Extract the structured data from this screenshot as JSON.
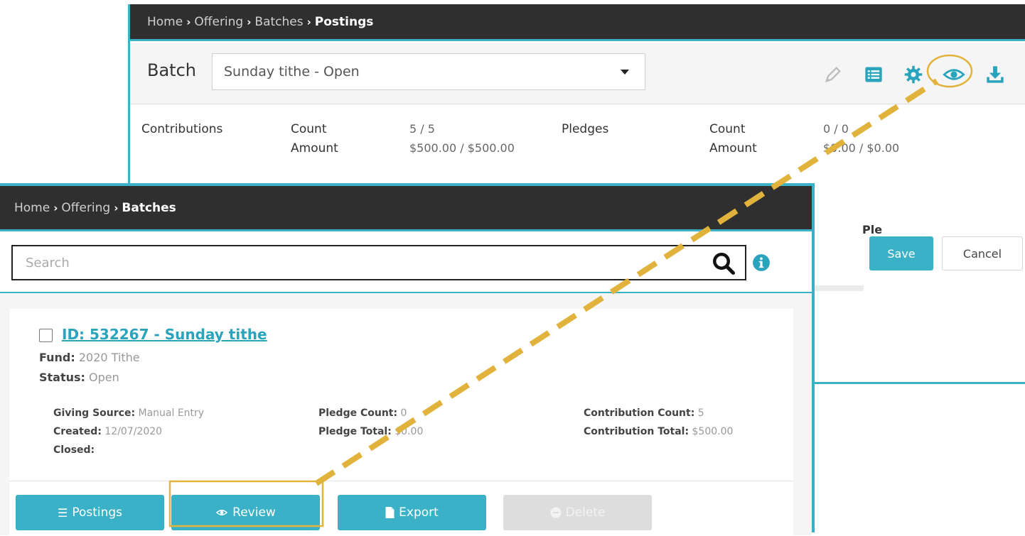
{
  "postings_window": {
    "breadcrumb": {
      "home": "Home",
      "offering": "Offering",
      "batches": "Batches",
      "current": "Postings"
    },
    "batch_label": "Batch",
    "batch_select_value": "Sunday tithe - Open",
    "toolbar_icons": [
      "pencil-icon",
      "list-icon",
      "gear-icon",
      "eye-icon",
      "download-icon"
    ],
    "contributions": {
      "label": "Contributions",
      "count_label": "Count",
      "amount_label": "Amount",
      "count_value": "5 / 5",
      "amount_value": "$500.00 / $500.00"
    },
    "pledges": {
      "label": "Pledges",
      "count_label": "Count",
      "amount_label": "Amount",
      "count_value": "0 / 0",
      "amount_value": "$0.00 / $0.00"
    },
    "ple_text": "Ple",
    "save_label": "Save",
    "cancel_label": "Cancel"
  },
  "batches_window": {
    "breadcrumb": {
      "home": "Home",
      "offering": "Offering",
      "current": "Batches"
    },
    "search_placeholder": "Search",
    "card": {
      "title": "ID: 532267 - Sunday tithe",
      "fund_label": "Fund:",
      "fund_value": "2020 Tithe",
      "status_label": "Status:",
      "status_value": "Open",
      "giving_source_label": "Giving Source:",
      "giving_source_value": "Manual Entry",
      "created_label": "Created:",
      "created_value": "12/07/2020",
      "closed_label": "Closed:",
      "closed_value": "",
      "pledge_count_label": "Pledge Count:",
      "pledge_count_value": "0",
      "pledge_total_label": "Pledge Total:",
      "pledge_total_value": "$0.00",
      "contribution_count_label": "Contribution Count:",
      "contribution_count_value": "5",
      "contribution_total_label": "Contribution Total:",
      "contribution_total_value": "$500.00"
    },
    "actions": {
      "postings": "Postings",
      "review": "Review",
      "export": "Export",
      "delete": "Delete"
    }
  },
  "colors": {
    "accent": "#3ab1c7",
    "callout": "#e2b33c",
    "breadcrumb_bg": "#2f2f2f",
    "disabled": "#dddddd"
  }
}
